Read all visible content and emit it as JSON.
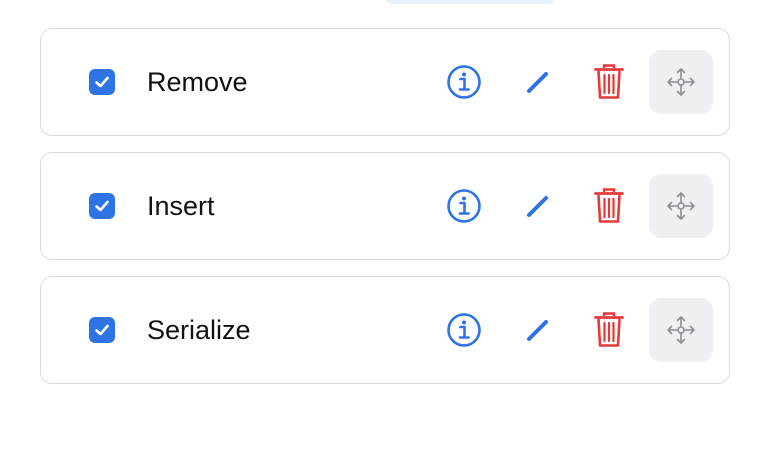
{
  "items": [
    {
      "label": "Remove",
      "checked": true
    },
    {
      "label": "Insert",
      "checked": true
    },
    {
      "label": "Serialize",
      "checked": true
    }
  ],
  "icons": {
    "checkbox": "checkmark-icon",
    "info": "info-icon",
    "edit": "pencil-icon",
    "delete": "trash-icon",
    "drag": "move-arrows-icon"
  },
  "colors": {
    "accent": "#2f74e6",
    "danger": "#e5393a",
    "drag_handle_bg": "#efeff4",
    "drag_icon": "#8e8e93",
    "border": "#dcdce0"
  }
}
